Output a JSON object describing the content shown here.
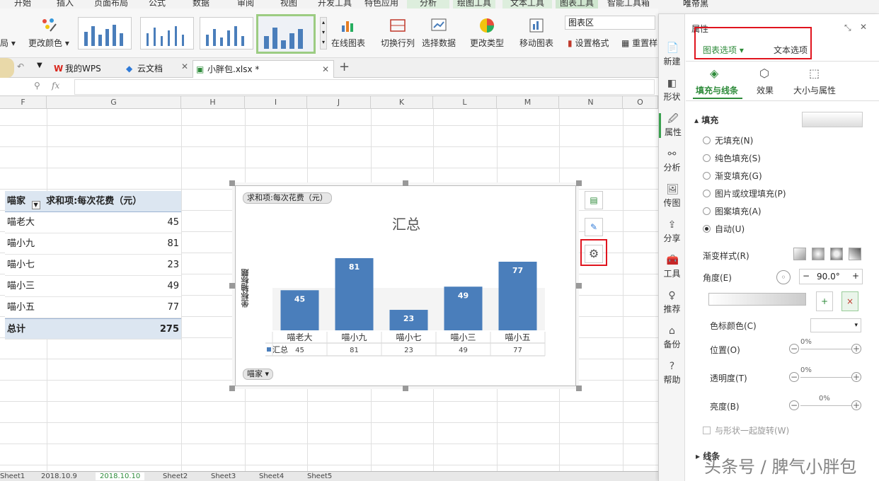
{
  "ribbon_tabs": [
    "开始",
    "插入",
    "页面布局",
    "公式",
    "数据",
    "审阅",
    "视图",
    "开发工具",
    "特色应用",
    "分析",
    "绘图工具",
    "文本工具",
    "图表工具",
    "智能工具箱"
  ],
  "ribbon": {
    "layout_label": "局",
    "change_color": "更改颜色",
    "online_chart": "在线图表",
    "switch_rowcol": "切换行列",
    "select_data": "选择数据",
    "change_type": "更改类型",
    "move_chart": "移动图表",
    "chart_area": "图表区",
    "set_format": "设置格式",
    "reset": "重置样"
  },
  "doc_tabs": {
    "wps": "我的WPS",
    "cloud": "云文档",
    "file": "小胖包.xlsx *"
  },
  "formula_bar": {
    "fx": "fx"
  },
  "columns": [
    "F",
    "G",
    "H",
    "I",
    "J",
    "K",
    "L",
    "M",
    "N",
    "O"
  ],
  "pivot": {
    "header_name": "喵家",
    "header_value": "求和项:每次花费（元）",
    "rows": [
      {
        "name": "喵老大",
        "value": "45"
      },
      {
        "name": "喵小九",
        "value": "81"
      },
      {
        "name": "喵小七",
        "value": "23"
      },
      {
        "name": "喵小三",
        "value": "49"
      },
      {
        "name": "喵小五",
        "value": "77"
      }
    ],
    "total_label": "总计",
    "total_value": "275"
  },
  "chart_data": {
    "type": "bar",
    "title": "汇总",
    "value_field": "求和项:每次花费（元）",
    "ylabel": "坐标轴标题",
    "axis_field": "喵家",
    "categories": [
      "喵老大",
      "喵小九",
      "喵小七",
      "喵小三",
      "喵小五"
    ],
    "series": [
      {
        "name": "汇总",
        "values": [
          45,
          81,
          23,
          49,
          77
        ]
      }
    ],
    "ylim": [
      0,
      100
    ],
    "legend": "data-table",
    "color": "#4a7ebb"
  },
  "panel": {
    "title": "属性",
    "tab_chart": "图表选项",
    "tab_text": "文本选项",
    "subtabs": [
      "填充与线条",
      "效果",
      "大小与属性"
    ],
    "nav": [
      "新建",
      "形状",
      "属性",
      "分析",
      "传图",
      "分享",
      "工具",
      "推荐",
      "备份",
      "帮助"
    ],
    "fill_title": "填充",
    "fill_options": [
      "无填充(N)",
      "纯色填充(S)",
      "渐变填充(G)",
      "图片或纹理填充(P)",
      "图案填充(A)",
      "自动(U)"
    ],
    "gradient_style": "渐变样式(R)",
    "angle_label": "角度(E)",
    "angle_value": "90.0°",
    "stop_color": "色标颜色(C)",
    "position": "位置(O)",
    "position_value": "0%",
    "transparency": "透明度(T)",
    "transparency_value": "0%",
    "brightness": "亮度(B)",
    "brightness_value": "0%",
    "rotate_with_shape": "与形状一起旋转(W)",
    "line": "线条"
  },
  "sheets": [
    "Sheet1",
    "2018.10.9",
    "2018.10.10",
    "Sheet2",
    "Sheet3",
    "Sheet4",
    "Sheet5"
  ],
  "watermark": "头条号 / 脾气小胖包",
  "top_right": "唯帝黑"
}
